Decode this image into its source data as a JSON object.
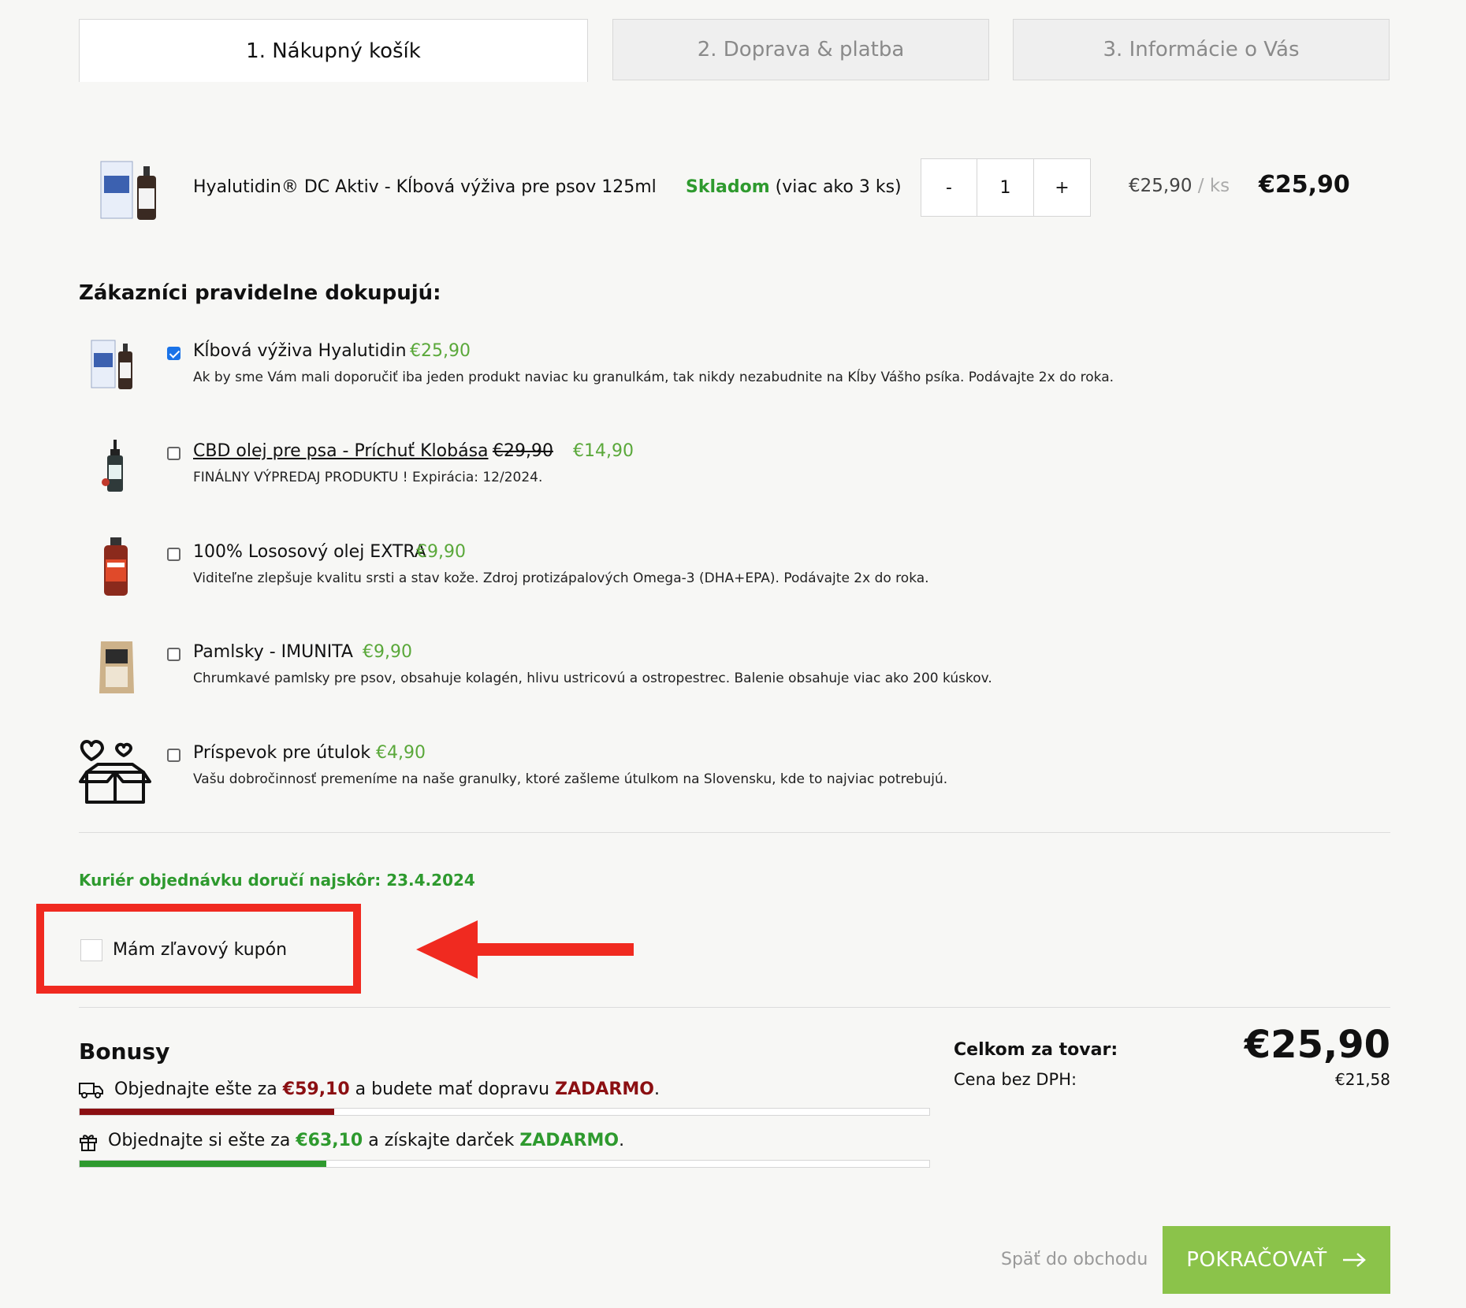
{
  "tabs": [
    {
      "label": "1. Nákupný košík",
      "active": true
    },
    {
      "label": "2. Doprava & platba",
      "active": false
    },
    {
      "label": "3. Informácie o Vás",
      "active": false
    }
  ],
  "cart_item": {
    "name": "Hyalutidin® DC Aktiv - Kĺbová výživa pre psov 125ml",
    "stock_status": "Skladom",
    "stock_detail": "(viac ako 3 ks)",
    "qty_minus": "-",
    "quantity": "1",
    "qty_plus": "+",
    "unit_price": "€25,90",
    "unit_sep": "/",
    "unit_label": "ks",
    "total": "€25,90"
  },
  "upsell": {
    "heading": "Zákazníci pravidelne dokupujú:",
    "items": [
      {
        "name": "Kĺbová výživa Hyalutidin",
        "price": "€25,90",
        "old_price": "",
        "checked": true,
        "description": "Ak by sme Vám mali doporučiť iba jeden produkt naviac ku granulkám, tak nikdy nezabudnite na Kĺby Vášho psíka. Podávajte 2x do roka.",
        "link": false
      },
      {
        "name": "CBD olej pre psa - Príchuť Klobása",
        "price": "€14,90",
        "old_price": "€29,90",
        "checked": false,
        "description": "FINÁLNY VÝPREDAJ PRODUKTU ! Expirácia: 12/2024.",
        "link": true
      },
      {
        "name": "100% Lososový olej EXTRA",
        "price": "€9,90",
        "old_price": "",
        "checked": false,
        "description": "Viditeľne zlepšuje kvalitu srsti a stav kože. Zdroj protizápalových Omega-3 (DHA+EPA). Podávajte 2x do roka.",
        "link": false
      },
      {
        "name": "Pamlsky - IMUNITA",
        "price": "€9,90",
        "old_price": "",
        "checked": false,
        "description": "Chrumkavé pamlsky pre psov, obsahuje kolagén, hlivu ustricovú a ostropestrec. Balenie obsahuje viac ako 200 kúskov.",
        "link": false
      },
      {
        "name": "Príspevok pre útulok",
        "price": "€4,90",
        "old_price": "",
        "checked": false,
        "description": "Vašu dobročinnosť premeníme na naše granulky, ktoré zašleme útulkom na Slovensku, kde to najviac potrebujú.",
        "link": false
      }
    ]
  },
  "delivery_note": "Kuriér objednávku doručí najskôr: 23.4.2024",
  "coupon": {
    "label": "Mám zľavový kupón",
    "checked": false
  },
  "bonuses": {
    "heading": "Bonusy",
    "shipping": {
      "pre": "Objednajte ešte za",
      "amount": "€59,10",
      "mid": "a budete mať dopravu",
      "highlight": "ZADARMO",
      "post": ".",
      "progress": 0.3
    },
    "gift": {
      "pre": "Objednajte si ešte za",
      "amount": "€63,10",
      "mid": "a získajte darček",
      "highlight": "ZADARMO",
      "post": ".",
      "progress": 0.29
    }
  },
  "summary": {
    "total_label": "Celkom za tovar:",
    "total_value": "€25,90",
    "net_label": "Cena bez DPH:",
    "net_value": "€21,58"
  },
  "actions": {
    "back": "Späť do obchodu",
    "continue": "POKRAČOVAŤ",
    "continue_icon": "arrow-right-icon"
  },
  "annotation": {
    "color": "#f02a20"
  },
  "colors": {
    "accent": "#8bc34a",
    "stock_green": "#2e9a2e",
    "price_green": "#5aa83a",
    "dark_red": "#8b0f12",
    "bar_green": "#2e9a2e"
  }
}
